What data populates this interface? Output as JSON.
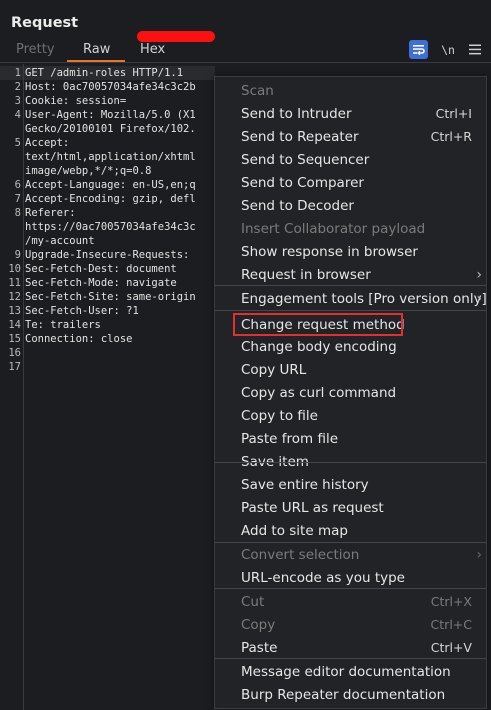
{
  "panel": {
    "title": "Request"
  },
  "tabs": [
    {
      "label": "Pretty",
      "active": false
    },
    {
      "label": "Raw",
      "active": true
    },
    {
      "label": "Hex",
      "active": false
    }
  ],
  "toolbar": {
    "wrap_icon": "word-wrap-icon",
    "newline_label": "\\n",
    "menu_icon": "hamburger-menu-icon"
  },
  "editor": {
    "line_numbers": [
      "1",
      "2",
      "3",
      "4",
      "",
      "5",
      "",
      "",
      "6",
      "7",
      "8",
      "",
      "",
      "9",
      "10",
      "11",
      "12",
      "13",
      "14",
      "15",
      "16",
      "17"
    ],
    "lines": [
      "GET /admin-roles HTTP/1.1",
      "Host: 0ac70057034afe34c3c2b",
      "Cookie: session=",
      "User-Agent: Mozilla/5.0 (X1",
      "Gecko/20100101 Firefox/102.",
      "Accept:",
      "text/html,application/xhtml",
      "image/webp,*/*;q=0.8",
      "Accept-Language: en-US,en;q",
      "Accept-Encoding: gzip, defl",
      "Referer:",
      "https://0ac70057034afe34c3c",
      "/my-account",
      "Upgrade-Insecure-Requests:",
      "Sec-Fetch-Dest: document",
      "Sec-Fetch-Mode: navigate",
      "Sec-Fetch-Site: same-origin",
      "Sec-Fetch-User: ?1",
      "Te: trailers",
      "Connection: close",
      "",
      ""
    ]
  },
  "context_menu": {
    "items": [
      {
        "label": "Scan",
        "shortcut": "",
        "disabled": true,
        "submenu": false
      },
      {
        "label": "Send to Intruder",
        "shortcut": "Ctrl+I",
        "disabled": false,
        "submenu": false
      },
      {
        "label": "Send to Repeater",
        "shortcut": "Ctrl+R",
        "disabled": false,
        "submenu": false
      },
      {
        "label": "Send to Sequencer",
        "shortcut": "",
        "disabled": false,
        "submenu": false
      },
      {
        "label": "Send to Comparer",
        "shortcut": "",
        "disabled": false,
        "submenu": false
      },
      {
        "label": "Send to Decoder",
        "shortcut": "",
        "disabled": false,
        "submenu": false
      },
      {
        "label": "Insert Collaborator payload",
        "shortcut": "",
        "disabled": true,
        "submenu": false
      },
      {
        "label": "Show response in browser",
        "shortcut": "",
        "disabled": false,
        "submenu": false
      },
      {
        "label": "Request in browser",
        "shortcut": "",
        "disabled": false,
        "submenu": true
      },
      {
        "label": "Engagement tools [Pro version only]",
        "shortcut": "",
        "disabled": false,
        "submenu": true
      },
      {
        "label": "Change request method",
        "shortcut": "",
        "disabled": false,
        "submenu": false,
        "highlighted": true
      },
      {
        "label": "Change body encoding",
        "shortcut": "",
        "disabled": false,
        "submenu": false
      },
      {
        "label": "Copy URL",
        "shortcut": "",
        "disabled": false,
        "submenu": false
      },
      {
        "label": "Copy as curl command",
        "shortcut": "",
        "disabled": false,
        "submenu": false
      },
      {
        "label": "Copy to file",
        "shortcut": "",
        "disabled": false,
        "submenu": false
      },
      {
        "label": "Paste from file",
        "shortcut": "",
        "disabled": false,
        "submenu": false
      },
      {
        "label": "Save item",
        "shortcut": "",
        "disabled": false,
        "submenu": false
      },
      {
        "label": "Save entire history",
        "shortcut": "",
        "disabled": false,
        "submenu": false
      },
      {
        "label": "Paste URL as request",
        "shortcut": "",
        "disabled": false,
        "submenu": false
      },
      {
        "label": "Add to site map",
        "shortcut": "",
        "disabled": false,
        "submenu": false
      },
      {
        "label": "Convert selection",
        "shortcut": "",
        "disabled": true,
        "submenu": true
      },
      {
        "label": "URL-encode as you type",
        "shortcut": "",
        "disabled": false,
        "submenu": false
      },
      {
        "label": "Cut",
        "shortcut": "Ctrl+X",
        "disabled": true,
        "submenu": false
      },
      {
        "label": "Copy",
        "shortcut": "Ctrl+C",
        "disabled": true,
        "submenu": false
      },
      {
        "label": "Paste",
        "shortcut": "Ctrl+V",
        "disabled": false,
        "submenu": false
      },
      {
        "label": "Message editor documentation",
        "shortcut": "",
        "disabled": false,
        "submenu": false
      },
      {
        "label": "Burp Repeater documentation",
        "shortcut": "",
        "disabled": false,
        "submenu": false
      }
    ]
  },
  "colors": {
    "background": "#1c1d20",
    "menu_background": "#222326",
    "accent_tab": "#e8752f",
    "highlight_box": "#e0312c",
    "redaction": "#ff1010",
    "toolbar_active": "#3e6ed8"
  }
}
